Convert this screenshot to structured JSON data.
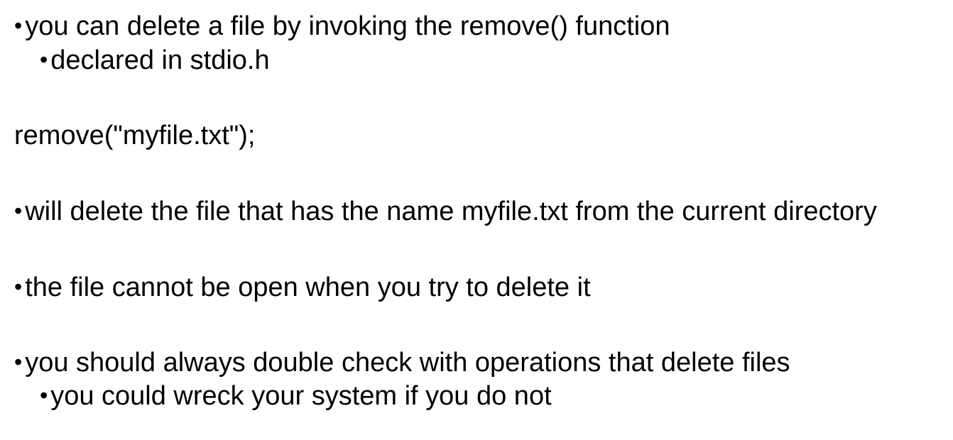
{
  "slide": {
    "bullet_glyph": "•",
    "lines": [
      {
        "text": "you can delete a file by invoking the remove() function"
      },
      {
        "text": "declared in stdio.h"
      },
      {
        "text": "remove(\"myfile.txt\");"
      },
      {
        "text": "will delete the file that has the name myfile.txt from the current directory"
      },
      {
        "text": "the file cannot be open when you try to delete it"
      },
      {
        "text": "you should always double check with operations that delete files"
      },
      {
        "text": "you could wreck your system if you do not"
      }
    ]
  }
}
